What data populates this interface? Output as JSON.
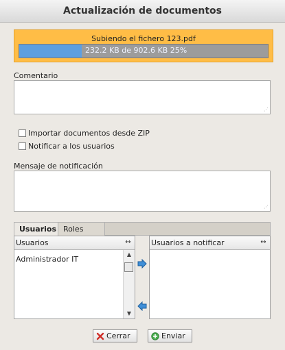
{
  "window": {
    "title": "Actualización de documentos"
  },
  "upload": {
    "title": "Subiendo el fichero 123.pdf",
    "progress_text": "232.2 KB de 902.6 KB 25%",
    "progress_percent": 25
  },
  "comment": {
    "label": "Comentario",
    "value": ""
  },
  "options": {
    "import_zip_label": "Importar documentos desde ZIP",
    "notify_users_label": "Notificar a los usuarios"
  },
  "notification": {
    "label": "Mensaje de notificación",
    "value": ""
  },
  "tabs": [
    {
      "label": "Usuarios"
    },
    {
      "label": "Roles"
    }
  ],
  "users_list": {
    "header": "Usuarios",
    "items": [
      "Administrador IT"
    ]
  },
  "notify_list": {
    "header": "Usuarios a notificar",
    "items": []
  },
  "buttons": {
    "close_label": "Cerrar",
    "send_label": "Enviar"
  },
  "colors": {
    "upload_bg": "#ffbd46",
    "progress_fill": "#5e9fe0",
    "progress_track": "#9c9c9c"
  }
}
